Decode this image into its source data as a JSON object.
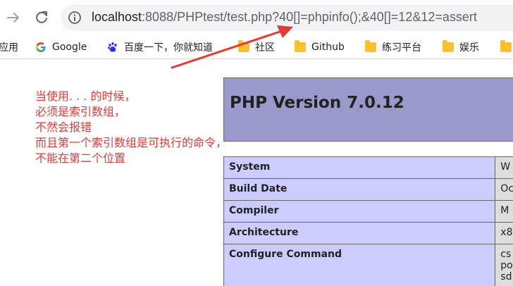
{
  "browser": {
    "url_host": "localhost",
    "url_rest": ":8088/PHPtest/test.php?40[]=phpinfo();&40[]=12&12=assert"
  },
  "bookmarks": [
    {
      "label": "应用",
      "icon": "apps-icon"
    },
    {
      "label": "Google",
      "icon": "google-icon"
    },
    {
      "label": "百度一下，你就知道",
      "icon": "baidu-icon"
    },
    {
      "label": "社区",
      "icon": "folder-icon"
    },
    {
      "label": "Github",
      "icon": "folder-icon"
    },
    {
      "label": "练习平台",
      "icon": "folder-icon"
    },
    {
      "label": "娱乐",
      "icon": "folder-icon"
    }
  ],
  "annotation": {
    "lines": [
      "当使用. . . 的时候，",
      "必须是索引数组，",
      "不然会报错",
      "而且第一个索引数组是可执行的命令，",
      "不能在第二个位置"
    ],
    "color": "#e53935"
  },
  "phpinfo": {
    "title": "PHP Version 7.0.12",
    "rows": [
      {
        "key": "System",
        "value": "W"
      },
      {
        "key": "Build Date",
        "value": "Oc"
      },
      {
        "key": "Compiler",
        "value": "M"
      },
      {
        "key": "Architecture",
        "value": "x8"
      },
      {
        "key": "Configure Command",
        "value_lines": [
          "cs",
          "po",
          "sd"
        ]
      }
    ],
    "header_color": "#9999cc",
    "key_color": "#ccccff",
    "value_color": "#dddddd"
  }
}
